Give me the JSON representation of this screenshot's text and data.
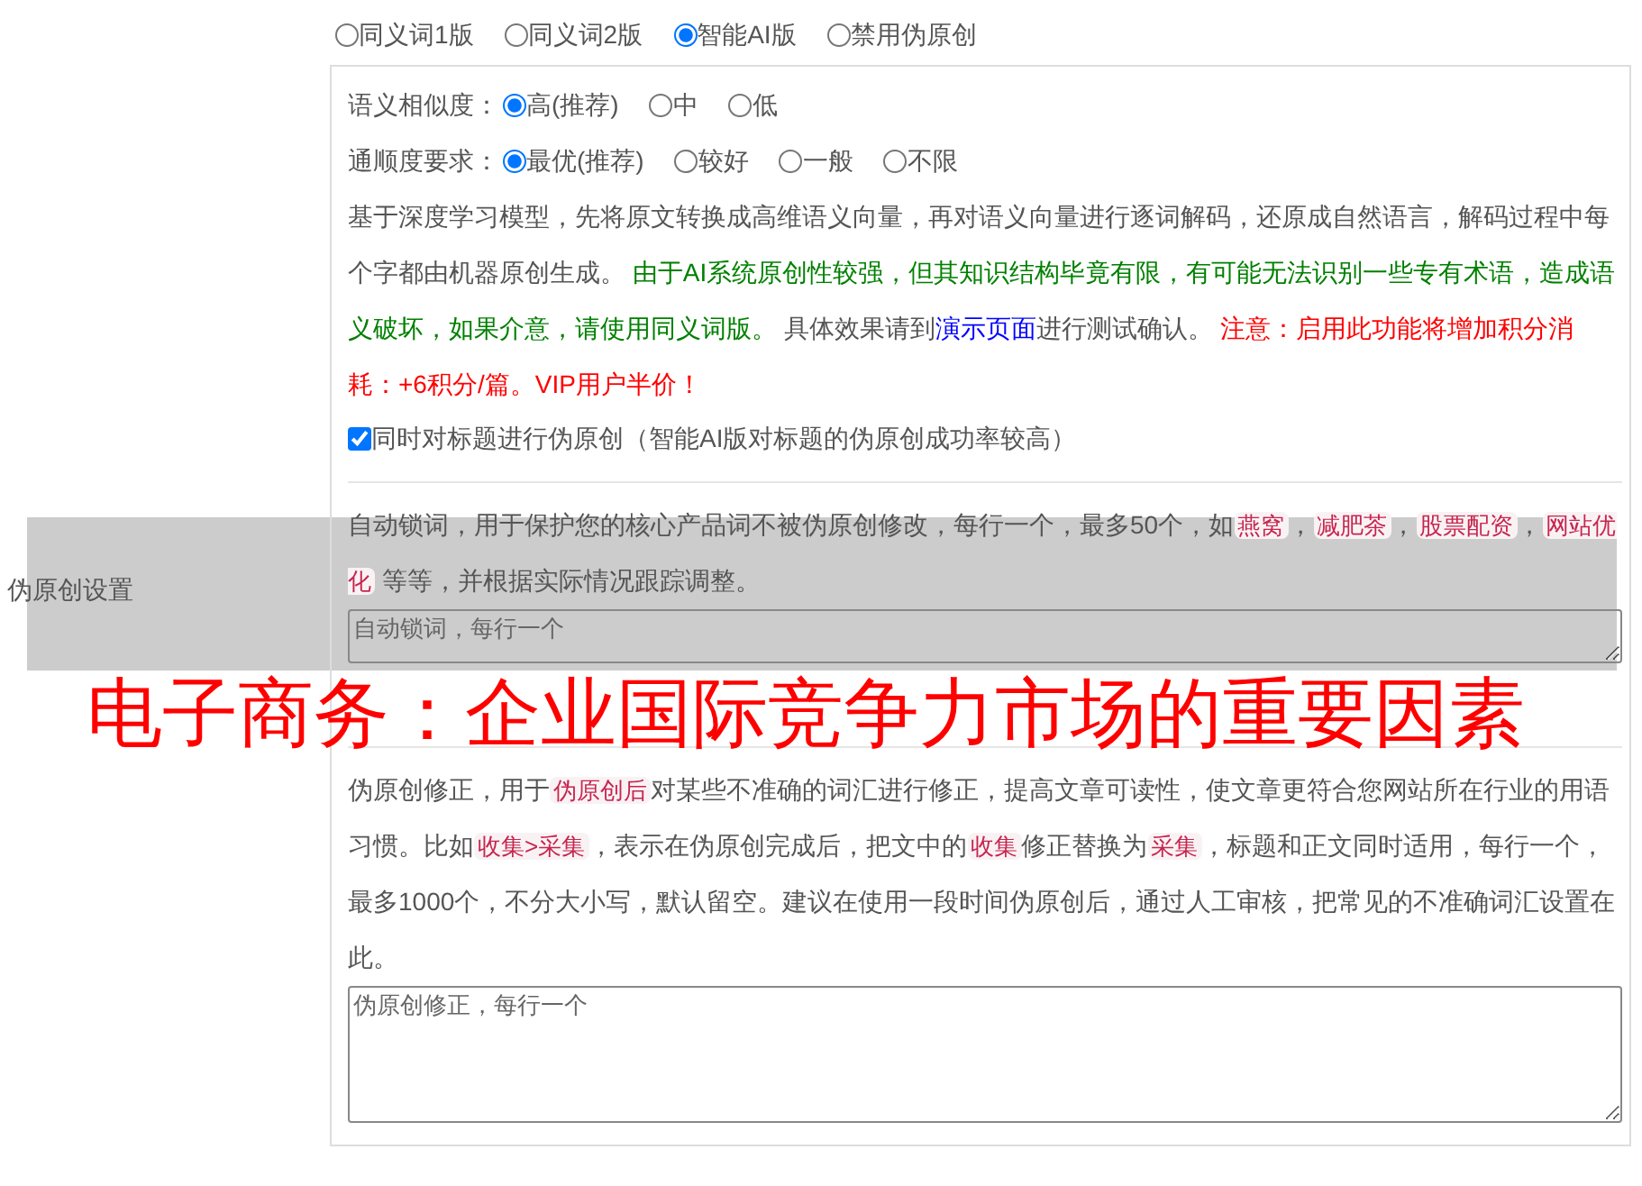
{
  "section_label": "伪原创设置",
  "mode_options": [
    {
      "label": "同义词1版",
      "selected": false
    },
    {
      "label": "同义词2版",
      "selected": false
    },
    {
      "label": "智能AI版",
      "selected": true
    },
    {
      "label": "禁用伪原创",
      "selected": false
    }
  ],
  "similarity": {
    "label": "语义相似度：",
    "options": [
      {
        "label": "高(推荐)",
        "selected": true
      },
      {
        "label": "中",
        "selected": false
      },
      {
        "label": "低",
        "selected": false
      }
    ]
  },
  "fluency": {
    "label": "通顺度要求：",
    "options": [
      {
        "label": "最优(推荐)",
        "selected": true
      },
      {
        "label": "较好",
        "selected": false
      },
      {
        "label": "一般",
        "selected": false
      },
      {
        "label": "不限",
        "selected": false
      }
    ]
  },
  "description": [
    {
      "kind": "plain",
      "text": "基于深度学习模型，先将原文转换成高维语义向量，再对语义向量进行逐词解码，还原成自然语言，解码过程中每个字都由机器原创生成。 "
    },
    {
      "kind": "notice",
      "text": "由于AI系统原创性较强，但其知识结构毕竟有限，有可能无法识别一些专有术语，造成语义破坏，如果介意，请使用同义词版。"
    },
    {
      "kind": "plain",
      "text": " 具体效果请到"
    },
    {
      "kind": "link",
      "text": "演示页面"
    },
    {
      "kind": "plain",
      "text": "进行测试确认。 "
    },
    {
      "kind": "warning",
      "text": "注意：启用此功能将增加积分消耗：+6积分/篇。VIP用户半价！"
    }
  ],
  "title_checkbox": {
    "label": "同时对标题进行伪原创（智能AI版对标题的伪原创成功率较高）",
    "checked": true
  },
  "lock_words": {
    "description": [
      {
        "kind": "plain",
        "text": "自动锁词，用于保护您的核心产品词不被伪原创修改，每行一个，最多50个，如"
      },
      {
        "kind": "code",
        "text": "燕窝"
      },
      {
        "kind": "plain",
        "text": "，"
      },
      {
        "kind": "code",
        "text": "减肥茶"
      },
      {
        "kind": "plain",
        "text": "，"
      },
      {
        "kind": "code",
        "text": "股票配资"
      },
      {
        "kind": "plain",
        "text": "，"
      },
      {
        "kind": "code",
        "text": "网站优化"
      },
      {
        "kind": "plain",
        "text": " 等等，并根据实际情况跟踪调整。"
      }
    ],
    "placeholder": "自动锁词，每行一个"
  },
  "correction": {
    "description": [
      {
        "kind": "plain",
        "text": "伪原创修正，用于"
      },
      {
        "kind": "code",
        "text": "伪原创后"
      },
      {
        "kind": "plain",
        "text": "对某些不准确的词汇进行修正，提高文章可读性，使文章更符合您网站所在行业的用语习惯。比如"
      },
      {
        "kind": "code",
        "text": "收集>采集"
      },
      {
        "kind": "plain",
        "text": "，表示在伪原创完成后，把文中的"
      },
      {
        "kind": "code",
        "text": "收集"
      },
      {
        "kind": "plain",
        "text": "修正替换为"
      },
      {
        "kind": "code",
        "text": "采集"
      },
      {
        "kind": "plain",
        "text": "，标题和正文同时适用，每行一个，最多1000个，不分大小写，默认留空。建议在使用一段时间伪原创后，通过人工审核，把常见的不准确词汇设置在此。"
      }
    ],
    "placeholder": "伪原创修正，每行一个"
  },
  "banner": {
    "title": "电子商务：企业国际竞争力市场的重要因素"
  }
}
